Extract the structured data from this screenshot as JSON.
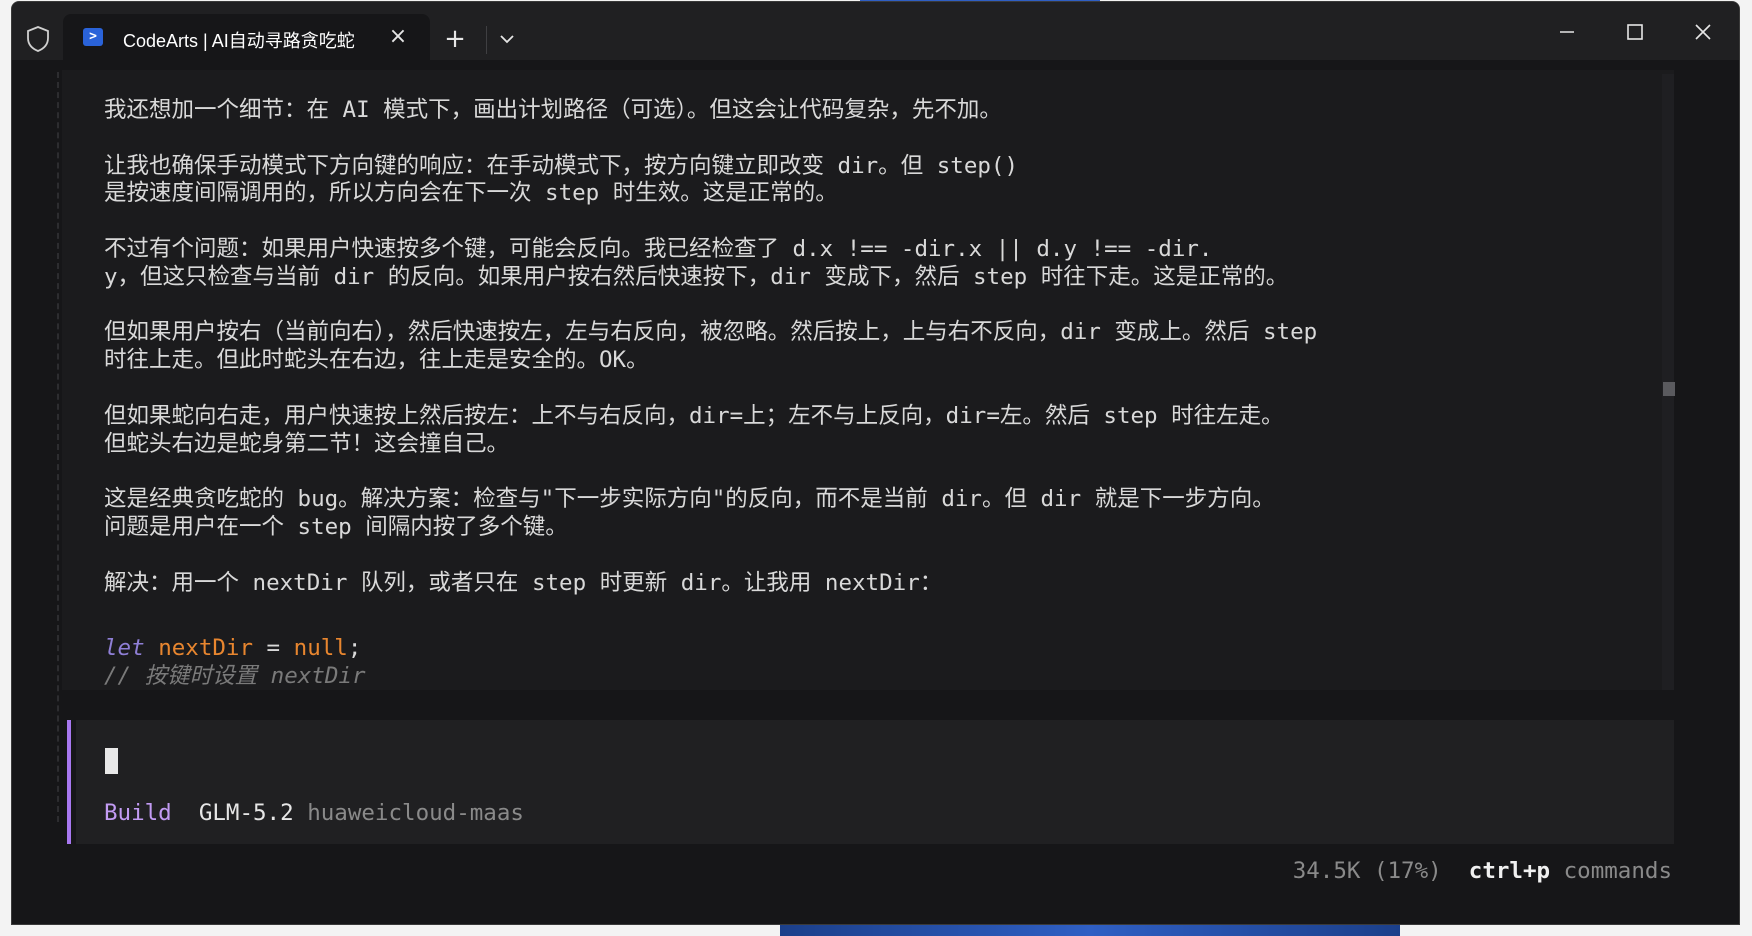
{
  "window": {
    "tab_title": "CodeArts | AI自动寻路贪吃蛇",
    "tab_icon": "terminal-icon",
    "new_tab": "+",
    "close": "×"
  },
  "transcript": [
    "我还想加一个细节：在 AI 模式下，画出计划路径（可选）。但这会让代码复杂，先不加。",
    "",
    "让我也确保手动模式下方向键的响应：在手动模式下，按方向键立即改变 dir。但 step()",
    "是按速度间隔调用的，所以方向会在下一次 step 时生效。这是正常的。",
    "",
    "不过有个问题：如果用户快速按多个键，可能会反向。我已经检查了 d.x !== -dir.x || d.y !== -dir.",
    "y，但这只检查与当前 dir 的反向。如果用户按右然后快速按下，dir 变成下，然后 step 时往下走。这是正常的。",
    "",
    "但如果用户按右（当前向右），然后快速按左，左与右反向，被忽略。然后按上，上与右不反向，dir 变成上。然后 step",
    "时往上走。但此时蛇头在右边，往上走是安全的。OK。",
    "",
    "但如果蛇向右走，用户快速按上然后按左：上不与右反向，dir=上；左不与上反向，dir=左。然后 step 时往左走。",
    "但蛇头右边是蛇身第二节！这会撞自己。",
    "",
    "这是经典贪吃蛇的 bug。解决方案：检查与\"下一步实际方向\"的反向，而不是当前 dir。但 dir 就是下一步方向。",
    "问题是用户在一个 step 间隔内按了多个键。",
    "",
    "解决：用一个 nextDir 队列，或者只在 step 时更新 dir。让我用 nextDir："
  ],
  "code": {
    "kw": "let",
    "var": "nextDir",
    "op": " = ",
    "val": "null",
    "end": ";",
    "comment": "// 按键时设置 nextDir"
  },
  "prompt": {
    "mode": "Build",
    "model": "GLM-5.2",
    "provider": "huaweicloud-maas"
  },
  "footer": {
    "tokens": "34.5K (17%)",
    "key": "ctrl+p",
    "label": " commands"
  },
  "colors": {
    "accent": "#a878f0",
    "keyword": "#8f7fd6",
    "variable": "#e8862f",
    "comment": "#7a7a7a"
  }
}
